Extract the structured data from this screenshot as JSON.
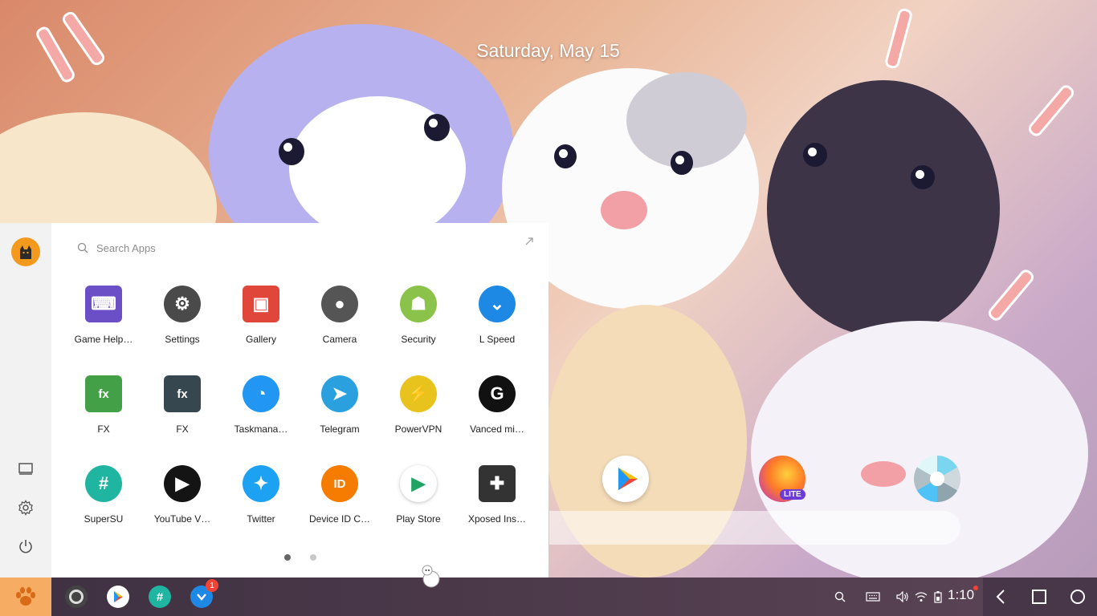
{
  "desktop": {
    "date": "Saturday, May 15",
    "icons": [
      "play-store-icon",
      "firefox-lite-icon",
      "camera-aperture-icon"
    ]
  },
  "start_menu": {
    "search_placeholder": "Search Apps",
    "apps": [
      {
        "label": "Game Help…",
        "icon": "keyboard-icon",
        "color": "#6a4fc7"
      },
      {
        "label": "Settings",
        "icon": "gear-icon",
        "color": "#4a4a4a"
      },
      {
        "label": "Gallery",
        "icon": "image-icon",
        "color": "#e0463a"
      },
      {
        "label": "Camera",
        "icon": "camera-icon",
        "color": "#555555"
      },
      {
        "label": "Security",
        "icon": "android-icon",
        "color": "#8bc34a"
      },
      {
        "label": "L Speed",
        "icon": "chevron-down-icon",
        "color": "#1e88e5"
      },
      {
        "label": "FX",
        "icon": "fx-sheet-icon",
        "color": "#43a047"
      },
      {
        "label": "FX",
        "icon": "fx-dark-icon",
        "color": "#37474f"
      },
      {
        "label": "Taskmana…",
        "icon": "pie-chart-icon",
        "color": "#2196f3"
      },
      {
        "label": "Telegram",
        "icon": "paper-plane-icon",
        "color": "#2aa1de"
      },
      {
        "label": "PowerVPN",
        "icon": "bolt-icon",
        "color": "#e8c31d"
      },
      {
        "label": "Vanced mi…",
        "icon": "g-icon",
        "color": "#111111"
      },
      {
        "label": "SuperSU",
        "icon": "hash-icon",
        "color": "#1fb5a0"
      },
      {
        "label": "YouTube V…",
        "icon": "play-button-icon",
        "color": "#141414"
      },
      {
        "label": "Twitter",
        "icon": "bird-icon",
        "color": "#1da1f2"
      },
      {
        "label": "Device ID C…",
        "icon": "id-card-icon",
        "color": "#f57c00"
      },
      {
        "label": "Play Store",
        "icon": "play-triangle-icon",
        "color": "#ffffff"
      },
      {
        "label": "Xposed Ins…",
        "icon": "puzzle-icon",
        "color": "#333333"
      }
    ],
    "page_count": 2,
    "current_page": 1
  },
  "taskbar": {
    "pinned": [
      "camera-icon",
      "play-store-icon",
      "supersu-icon",
      "l-speed-icon"
    ],
    "notification_badge": "1",
    "time": "1:10"
  }
}
